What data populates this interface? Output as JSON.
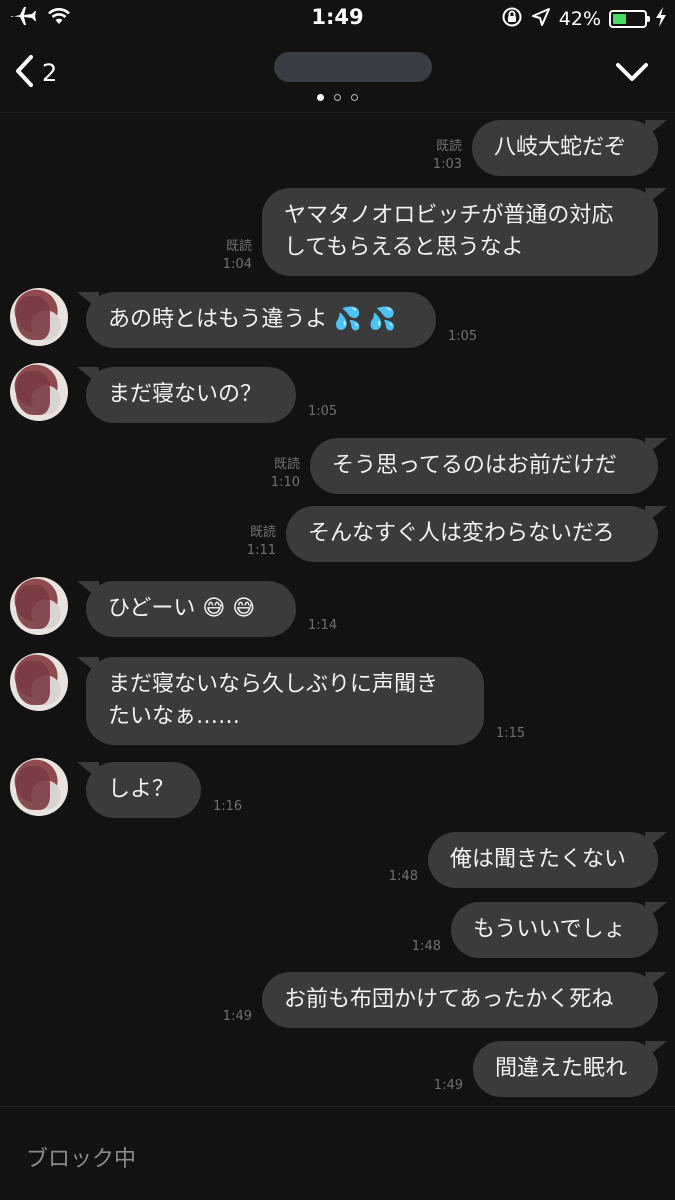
{
  "status_bar": {
    "time": "1:49",
    "battery_percent": "42%",
    "battery_level": 0.42,
    "icons": [
      "airplane-icon",
      "wifi-icon",
      "orientation-lock-icon",
      "location-icon",
      "battery-icon",
      "charging-bolt-icon"
    ]
  },
  "header": {
    "back_count": "2",
    "page_dots": [
      true,
      false,
      false
    ]
  },
  "messages": [
    {
      "dir": "out",
      "lines": [
        "八岐大蛇だぞ"
      ],
      "read": "既読",
      "time": "1:03"
    },
    {
      "dir": "out",
      "lines": [
        "ヤマタノオロビッチが普通の対応",
        "してもらえると思うなよ"
      ],
      "read": "既読",
      "time": "1:04"
    },
    {
      "dir": "in",
      "lines": [
        "あの時とはもう違うよ 💦 💦"
      ],
      "time": "1:05"
    },
    {
      "dir": "in",
      "lines": [
        "まだ寝ないの？"
      ],
      "time": "1:05"
    },
    {
      "dir": "out",
      "lines": [
        "そう思ってるのはお前だけだ"
      ],
      "read": "既読",
      "time": "1:10"
    },
    {
      "dir": "out",
      "lines": [
        "そんなすぐ人は変わらないだろ"
      ],
      "read": "既読",
      "time": "1:11"
    },
    {
      "dir": "in",
      "lines": [
        "ひどーい 😅 😅"
      ],
      "time": "1:14"
    },
    {
      "dir": "in",
      "lines": [
        "まだ寝ないなら久しぶりに声聞き",
        "たいなぁ……"
      ],
      "time": "1:15"
    },
    {
      "dir": "in",
      "lines": [
        "しよ？"
      ],
      "time": "1:16"
    },
    {
      "dir": "out",
      "lines": [
        "俺は聞きたくない"
      ],
      "time": "1:48"
    },
    {
      "dir": "out",
      "lines": [
        "もういいでしょ"
      ],
      "time": "1:48"
    },
    {
      "dir": "out",
      "lines": [
        "お前も布団かけてあったかく死ね"
      ],
      "time": "1:49"
    },
    {
      "dir": "out",
      "lines": [
        "間違えた眠れ"
      ],
      "time": "1:49"
    }
  ],
  "footer": {
    "status": "ブロック中"
  }
}
